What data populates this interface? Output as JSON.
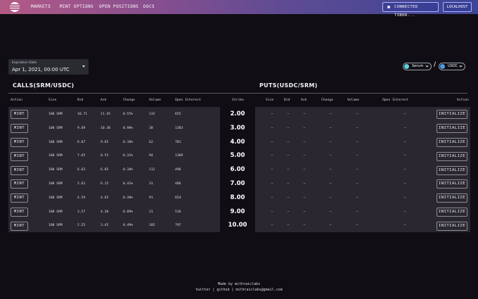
{
  "nav": {
    "links": [
      "MARKETS",
      "MINT OPTIONS",
      "OPEN POSITIONS",
      "DOCS"
    ],
    "wallet_label": "CONNECTED TXBRR...",
    "network_label": "LOCALHOST"
  },
  "expiration": {
    "label": "Expiration Date",
    "value": "Apr 1, 2021, 00:00 UTC"
  },
  "pair": {
    "base": "Serum",
    "quote": "USDC",
    "separator": "/"
  },
  "calls": {
    "title": "CALLS(SRM/USDC)",
    "headers": [
      "Action",
      "Size",
      "Bid",
      "Ask",
      "Change",
      "Volume",
      "Open Interest"
    ]
  },
  "puts": {
    "title": "PUTS(USDC/SRM)",
    "headers": [
      "Size",
      "Bid",
      "Ask",
      "Change",
      "Volume",
      "Open Interest",
      "Action"
    ]
  },
  "strike_header": "Strike",
  "rows": [
    {
      "strike": "2.00",
      "call": {
        "action": "MINT",
        "size": "100 SRM",
        "bid": "10.71",
        "ask": "11.45",
        "change": "0.55%",
        "volume": "132",
        "open_interest": "655"
      },
      "put": {
        "size": "–",
        "bid": "–",
        "ask": "–",
        "change": "–",
        "volume": "–",
        "open_interest": "–",
        "action": "INITIALIZE"
      }
    },
    {
      "strike": "3.00",
      "call": {
        "action": "MINT",
        "size": "100 SRM",
        "bid": "9.69",
        "ask": "10.30",
        "change": "0.90%",
        "volume": "38",
        "open_interest": "1383"
      },
      "put": {
        "size": "–",
        "bid": "–",
        "ask": "–",
        "change": "–",
        "volume": "–",
        "open_interest": "–",
        "action": "INITIALIZE"
      }
    },
    {
      "strike": "4.00",
      "call": {
        "action": "MINT",
        "size": "100 SRM",
        "bid": "8.67",
        "ask": "9.65",
        "change": "0.18%",
        "volume": "62",
        "open_interest": "781"
      },
      "put": {
        "size": "–",
        "bid": "–",
        "ask": "–",
        "change": "–",
        "volume": "–",
        "open_interest": "–",
        "action": "INITIALIZE"
      }
    },
    {
      "strike": "5.00",
      "call": {
        "action": "MINT",
        "size": "100 SRM",
        "bid": "7.65",
        "ask": "8.55",
        "change": "0.31%",
        "volume": "94",
        "open_interest": "1309"
      },
      "put": {
        "size": "–",
        "bid": "–",
        "ask": "–",
        "change": "–",
        "volume": "–",
        "open_interest": "–",
        "action": "INITIALIZE"
      }
    },
    {
      "strike": "6.00",
      "call": {
        "action": "MINT",
        "size": "100 SRM",
        "bid": "6.63",
        "ask": "6.85",
        "change": "0.18%",
        "volume": "112",
        "open_interest": "496"
      },
      "put": {
        "size": "–",
        "bid": "–",
        "ask": "–",
        "change": "–",
        "volume": "–",
        "open_interest": "–",
        "action": "INITIALIZE"
      }
    },
    {
      "strike": "7.00",
      "call": {
        "action": "MINT",
        "size": "100 SRM",
        "bid": "5.61",
        "ask": "6.15",
        "change": "0.41%",
        "volume": "31",
        "open_interest": "486"
      },
      "put": {
        "size": "–",
        "bid": "–",
        "ask": "–",
        "change": "–",
        "volume": "–",
        "open_interest": "–",
        "action": "INITIALIZE"
      }
    },
    {
      "strike": "8.00",
      "call": {
        "action": "MINT",
        "size": "100 SRM",
        "bid": "4.59",
        "ask": "4.65",
        "change": "0.38%",
        "volume": "91",
        "open_interest": "654"
      },
      "put": {
        "size": "–",
        "bid": "–",
        "ask": "–",
        "change": "–",
        "volume": "–",
        "open_interest": "–",
        "action": "INITIALIZE"
      }
    },
    {
      "strike": "9.00",
      "call": {
        "action": "MINT",
        "size": "100 SRM",
        "bid": "3.57",
        "ask": "4.30",
        "change": "0.89%",
        "volume": "21",
        "open_interest": "516"
      },
      "put": {
        "size": "–",
        "bid": "–",
        "ask": "–",
        "change": "–",
        "volume": "–",
        "open_interest": "–",
        "action": "INITIALIZE"
      }
    },
    {
      "strike": "10.00",
      "call": {
        "action": "MINT",
        "size": "100 SRM",
        "bid": "2.55",
        "ask": "3.45",
        "change": "0.49%",
        "volume": "105",
        "open_interest": "797"
      },
      "put": {
        "size": "–",
        "bid": "–",
        "ask": "–",
        "change": "–",
        "volume": "–",
        "open_interest": "–",
        "action": "INITIALIZE"
      }
    }
  ],
  "footer": {
    "made_by": "Made by mithraiclabs",
    "links": [
      "twitter",
      "github",
      "mithraiclabs@gmail.com"
    ],
    "separator": "|"
  },
  "colors": {
    "nav_start": "#b35a86",
    "nav_end": "#3d4596",
    "background": "#100e14",
    "panel": "#2a2730",
    "serum_coin": "#5fd0e0",
    "usdc_coin": "#4e9be6"
  },
  "icons": [
    "app-logo-icon",
    "wallet-status-dot-icon",
    "caret-down-icon",
    "chevron-down-icon"
  ]
}
